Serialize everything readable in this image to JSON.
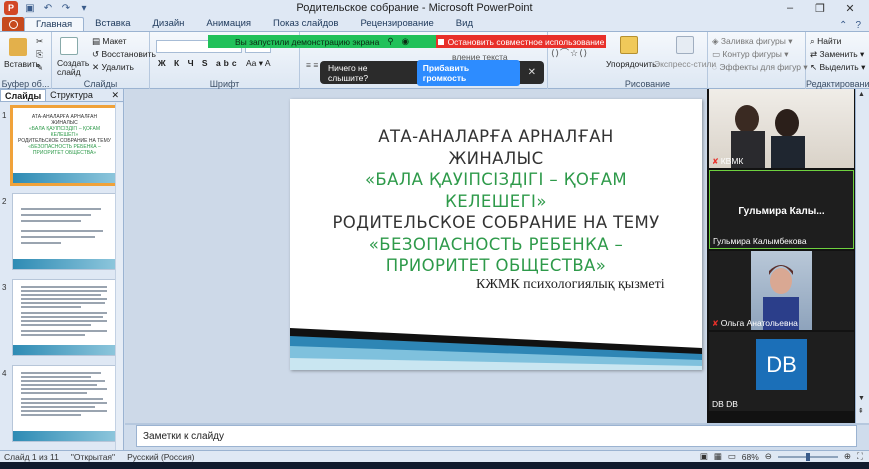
{
  "window": {
    "title": "Родительское собрание - Microsoft PowerPoint",
    "controls": [
      "–",
      "❐",
      "✕"
    ]
  },
  "tabs": [
    "Главная",
    "Вставка",
    "Дизайн",
    "Анимация",
    "Показ слайдов",
    "Рецензирование",
    "Вид"
  ],
  "ribbon": {
    "paste": "Вставить",
    "create_slide": "Создать слайд",
    "layout": "Макет",
    "restore": "Восстановить",
    "delete": "Удалить",
    "clipboard_group": "Буфер об...",
    "slides_group": "Слайды",
    "font_group": "Шрифт",
    "arrange": "Упорядочить",
    "express_styles": "Экспресс-стили",
    "shape_fill": "Заливка фигуры",
    "shape_outline": "Контур фигуры",
    "shape_effects": "Эффекты для фигур",
    "drawing_group": "Рисование",
    "find": "Найти",
    "replace": "Заменить",
    "select": "Выделить",
    "editing_group": "Редактирование",
    "direction_text": "вление текста"
  },
  "meeting": {
    "demo_banner": "Вы запустили демонстрацию экрана",
    "stop_share": "Остановить совместное использование",
    "toast_text": "Ничего не слышите?",
    "toast_button": "Прибавить громкость",
    "toast_close": "✕"
  },
  "leftpane": {
    "tab_slides": "Слайды",
    "tab_structure": "Структура",
    "close": "✕",
    "thumb_numbers": [
      "1",
      "2",
      "3",
      "4"
    ]
  },
  "slide": {
    "line1": "АТА-АНАЛАРҒА АРНАЛҒАН",
    "line2": "ЖИНАЛЫС",
    "line3": "«БАЛА ҚАУІПСІЗДІГІ – ҚОҒАМ",
    "line4": "КЕЛЕШЕГІ»",
    "line5": "РОДИТЕЛЬСКОЕ СОБРАНИЕ НА ТЕМУ",
    "line6": "«БЕЗОПАСНОСТЬ РЕБЕНКА –",
    "line7": "ПРИОРИТЕТ ОБЩЕСТВА»",
    "subtitle": "КЖМК психологиялық қызметі"
  },
  "notes_placeholder": "Заметки к слайду",
  "participants": [
    {
      "name": "КВМК",
      "muted": true
    },
    {
      "name": "Гульмира Калымбекова",
      "display": "Гульмира  Калы...",
      "muted": false
    },
    {
      "name": "Ольга Анатольевна",
      "muted": true
    },
    {
      "name": "DB DB",
      "initials": "DB",
      "muted": false
    }
  ],
  "status": {
    "slide_of": "Слайд 1 из 11",
    "theme": "\"Открытая\"",
    "language": "Русский (Россия)",
    "zoom": "68%"
  },
  "colors": {
    "title_green": "#2e9a4a",
    "banner_green": "#21c15a",
    "banner_red": "#e8302a",
    "file_tab": "#c64a1e"
  }
}
